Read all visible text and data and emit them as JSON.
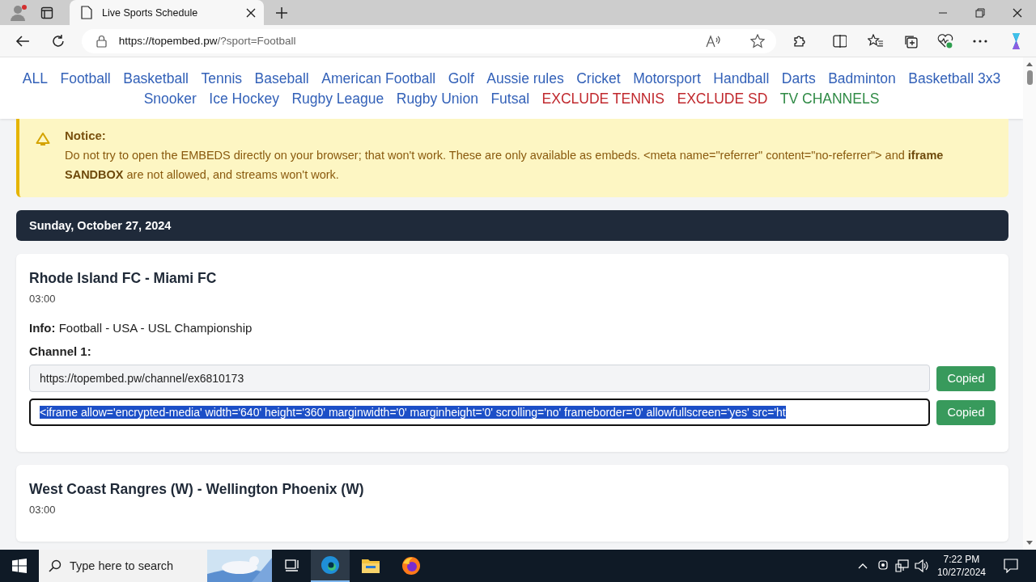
{
  "browser": {
    "tab_title": "Live Sports Schedule",
    "url_host": "https://topembed.pw",
    "url_rest": "/?sport=Football"
  },
  "nav": [
    {
      "label": "ALL",
      "kind": "sport"
    },
    {
      "label": "Football",
      "kind": "sport"
    },
    {
      "label": "Basketball",
      "kind": "sport"
    },
    {
      "label": "Tennis",
      "kind": "sport"
    },
    {
      "label": "Baseball",
      "kind": "sport"
    },
    {
      "label": "American Football",
      "kind": "sport"
    },
    {
      "label": "Golf",
      "kind": "sport"
    },
    {
      "label": "Aussie rules",
      "kind": "sport"
    },
    {
      "label": "Cricket",
      "kind": "sport"
    },
    {
      "label": "Motorsport",
      "kind": "sport"
    },
    {
      "label": "Handball",
      "kind": "sport"
    },
    {
      "label": "Darts",
      "kind": "sport"
    },
    {
      "label": "Badminton",
      "kind": "sport"
    },
    {
      "label": "Basketball 3x3",
      "kind": "sport"
    },
    {
      "label": "Snooker",
      "kind": "sport"
    },
    {
      "label": "Ice Hockey",
      "kind": "sport"
    },
    {
      "label": "Rugby League",
      "kind": "sport"
    },
    {
      "label": "Rugby Union",
      "kind": "sport"
    },
    {
      "label": "Futsal",
      "kind": "sport"
    },
    {
      "label": "EXCLUDE TENNIS",
      "kind": "exclude"
    },
    {
      "label": "EXCLUDE SD",
      "kind": "exclude"
    },
    {
      "label": "TV CHANNELS",
      "kind": "channels"
    }
  ],
  "notice": {
    "title": "Notice:",
    "text": "Do not try to open the EMBEDS directly on your browser; that won't work. These are only available as embeds. <meta name=\"referrer\" content=\"no-referrer\"> and **iframe SANDBOX** are not allowed, and streams won't work."
  },
  "date": "Sunday, October 27, 2024",
  "events": [
    {
      "title": "Rhode Island FC - Miami FC",
      "time": "03:00",
      "info_label": "Info:",
      "info": "Football - USA - USL Championship",
      "channel_label": "Channel 1:",
      "fields": [
        {
          "value": "https://topembed.pw/channel/ex6810173",
          "highlighted": false,
          "focused": false,
          "button": "Copied"
        },
        {
          "value": "<iframe allow='encrypted-media' width='640' height='360' marginwidth='0' marginheight='0' scrolling='no' frameborder='0' allowfullscreen='yes' src='ht",
          "highlighted": true,
          "focused": true,
          "button": "Copied"
        }
      ]
    },
    {
      "title": "West Coast Rangres (W) - Wellington Phoenix (W)",
      "time": "03:00"
    }
  ],
  "taskbar": {
    "search_placeholder": "Type here to search",
    "time": "7:22 PM",
    "date": "10/27/2024"
  }
}
